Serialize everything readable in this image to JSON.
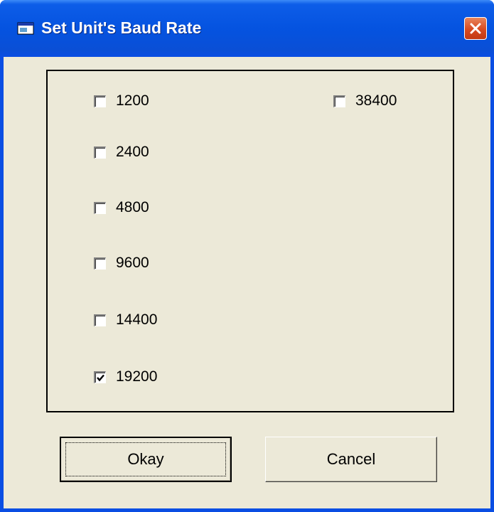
{
  "window": {
    "title": "Set Unit's Baud Rate",
    "title_icon": "app-window-icon",
    "close_icon": "close-icon"
  },
  "options": [
    {
      "label": "1200",
      "checked": false
    },
    {
      "label": "2400",
      "checked": false
    },
    {
      "label": "4800",
      "checked": false
    },
    {
      "label": "9600",
      "checked": false
    },
    {
      "label": "14400",
      "checked": false
    },
    {
      "label": "19200",
      "checked": true
    },
    {
      "label": "38400",
      "checked": false
    }
  ],
  "buttons": {
    "okay_label": "Okay",
    "cancel_label": "Cancel"
  }
}
